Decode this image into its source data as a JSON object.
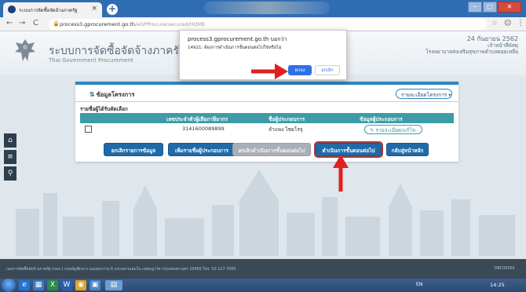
{
  "browser": {
    "tab_title": "ระบบการจัดซื้อจัดจ้างภาครัฐ",
    "tab_close": "×",
    "new_tab": "+",
    "url_host": "process3.gprocurement.go.th",
    "url_path": "/eGPProcure/secured/HOME",
    "nav_back": "←",
    "nav_forward": "→",
    "nav_reload": "C",
    "star_icon": "☆",
    "menu_icon": "⋮",
    "profile_icon": "☺",
    "window_min": "─",
    "window_max": "□",
    "window_close": "✕"
  },
  "header": {
    "site_title": "ระบบการจัดซื้อจัดจ้างภาครัฐ",
    "site_subtitle": "Thai Government Procurement",
    "date": "24 กันยายน 2562",
    "link1": "เจ้าหน้าที่พัสดุ",
    "link2": "โรงพยาบาลส่งเสริมสุขภาพตำบลดอยเหลือ"
  },
  "dialog": {
    "title": "process3.gprocurement.go.th บอกว่า",
    "message": "14921: ต้องการดำเนินการขั้นตอนต่อไปใช่หรือไม่",
    "ok_label": "ตกลง",
    "cancel_label": "ยกเลิก"
  },
  "card": {
    "title": "ข้อมูลโครงการ",
    "title_icon": "⇅",
    "detail_dropdown": "รายละเอียดโครงการ ▾",
    "section_label": "รายชื่อผู้ได้รับคัดเลือก",
    "columns": [
      "เลขประจำตัวผู้เสียภาษีอากร",
      "ชื่อผู้ประกอบการ",
      "ข้อมูลผู้ประกอบการ"
    ],
    "rows": [
      {
        "tax_id": "3141600089899",
        "name": "ลำแพง ไชยโรจุ",
        "action": "รายละเอียด/แก้ไข"
      }
    ],
    "edit_icon": "✎",
    "buttons": {
      "cancel_info": "ยกเลิกรายการข้อมูล",
      "add_vendor": "เพิ่มรายชื่อผู้ประกอบการ",
      "cancel_next": "ยกเลิกดำเนินการขั้นตอนต่อไป",
      "next_step": "ดำเนินการขั้นตอนต่อไป",
      "back_home": "กลับสู่หน้าหลัก"
    }
  },
  "sidemenu": {
    "home_icon": "⌂",
    "menu_icon": "≡",
    "search_icon": "⚲"
  },
  "footer": {
    "text": "กองการจัดซื้อจัดจ้างภาครัฐ (กพภ.) กรมบัญชีกลาง ถนนพระราม 6 แขวงสามเสนใน เขตพญาไท กรุงเทพมหานคร 10400 โทร. 02-127-7000",
    "code": "DRC00001"
  },
  "taskbar": {
    "lang": "EN",
    "time": "14:25"
  },
  "colors": {
    "accent": "#1f6aa8",
    "table_header": "#3d9ca8",
    "arrow": "#e02020",
    "dialog_ok": "#2d70e8"
  }
}
